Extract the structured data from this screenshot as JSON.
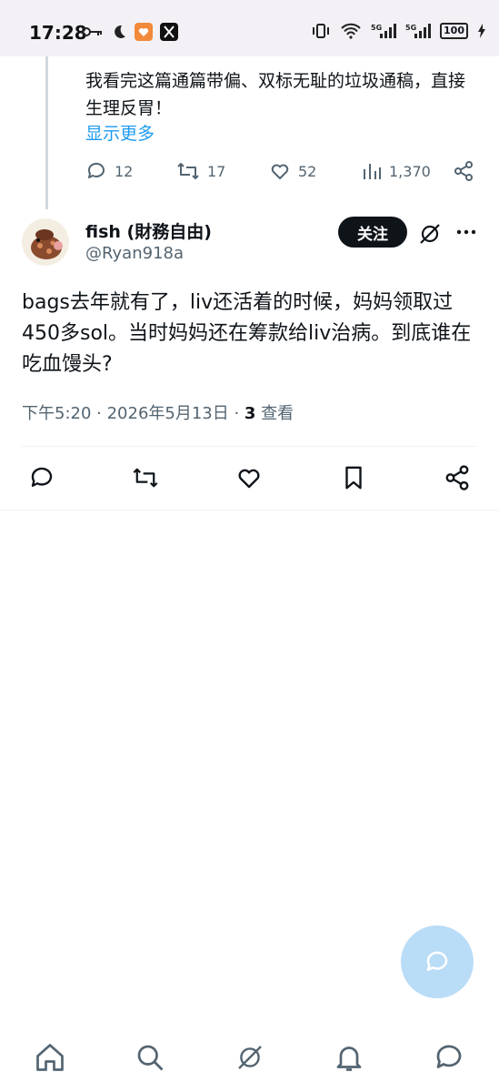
{
  "status_bar": {
    "time": "17:28",
    "left_icons": [
      "key-icon",
      "moon-icon",
      "app-heart-icon",
      "x-app-icon"
    ],
    "right_icons": [
      "vibrate-icon",
      "wifi-icon",
      "signal-5g-icon",
      "signal-5g-icon-2"
    ],
    "battery": "100"
  },
  "previous_reply": {
    "text": "我看完这篇通篇带偏、双标无耻的垃圾通稿，直接生理反胃！",
    "show_more": "显示更多",
    "replies": "12",
    "reposts": "17",
    "likes": "52",
    "views": "1,370"
  },
  "tweet": {
    "display_name": "fish (財務自由)",
    "handle": "@Ryan918a",
    "follow_label": "关注",
    "text": "bags去年就有了，liv还活着的时候，妈妈领取过450多sol。当时妈妈还在筹款给liv治病。到底谁在吃血馒头?",
    "timestamp": "下午5:20 · 2026年5月13日 · ",
    "views_count": "3",
    "views_label": " 查看"
  },
  "colors": {
    "accent": "#1d9bf0",
    "text": "#0f1419",
    "secondary": "#536471",
    "fab": "#b9dcf7"
  }
}
